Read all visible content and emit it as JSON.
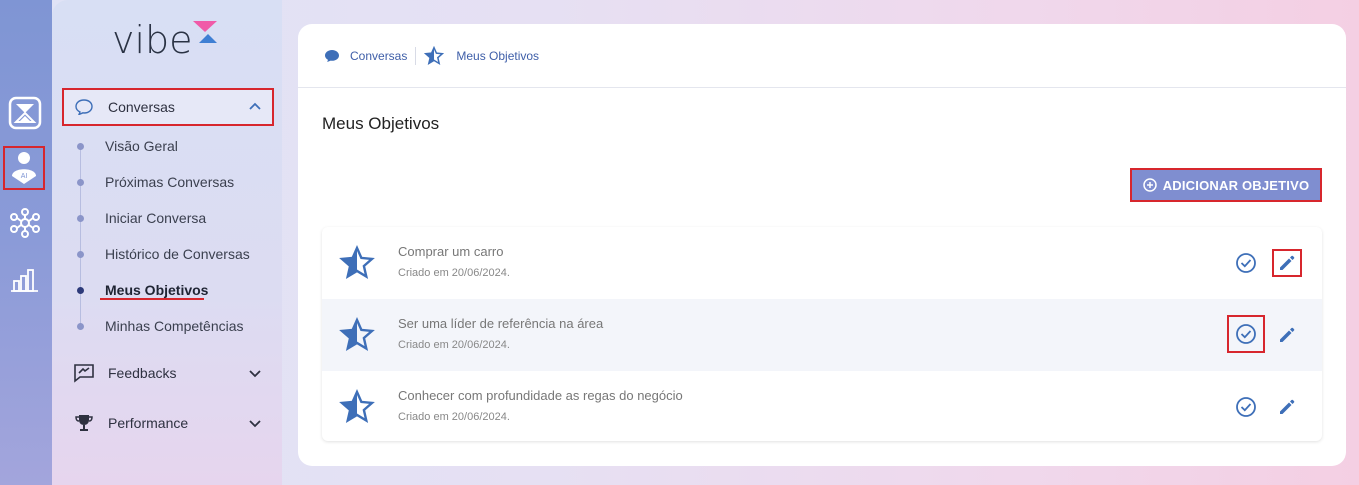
{
  "brand": {
    "logo_text": "vibe"
  },
  "rail": {
    "items": [
      "hourglass-icon",
      "ai-profile-icon",
      "network-icon",
      "bar-chart-icon"
    ]
  },
  "sidebar": {
    "conversas_label": "Conversas",
    "sub_items": [
      {
        "label": "Visão Geral"
      },
      {
        "label": "Próximas Conversas"
      },
      {
        "label": "Iniciar Conversa"
      },
      {
        "label": "Histórico de Conversas"
      },
      {
        "label": "Meus Objetivos"
      },
      {
        "label": "Minhas Competências"
      }
    ],
    "feedbacks_label": "Feedbacks",
    "performance_label": "Performance"
  },
  "breadcrumb": {
    "first": "Conversas",
    "second": "Meus Objetivos"
  },
  "page": {
    "title": "Meus Objetivos",
    "add_button": "ADICIONAR OBJETIVO"
  },
  "objectives": [
    {
      "title": "Comprar um carro",
      "date": "Criado em 20/06/2024."
    },
    {
      "title": "Ser uma líder de referência na área",
      "date": "Criado em 20/06/2024."
    },
    {
      "title": "Conhecer com profundidade as regas do negócio",
      "date": "Criado em 20/06/2024."
    }
  ],
  "colors": {
    "accent": "#3e6fb8",
    "button": "#7f8ed0",
    "highlight": "#d7262d"
  }
}
